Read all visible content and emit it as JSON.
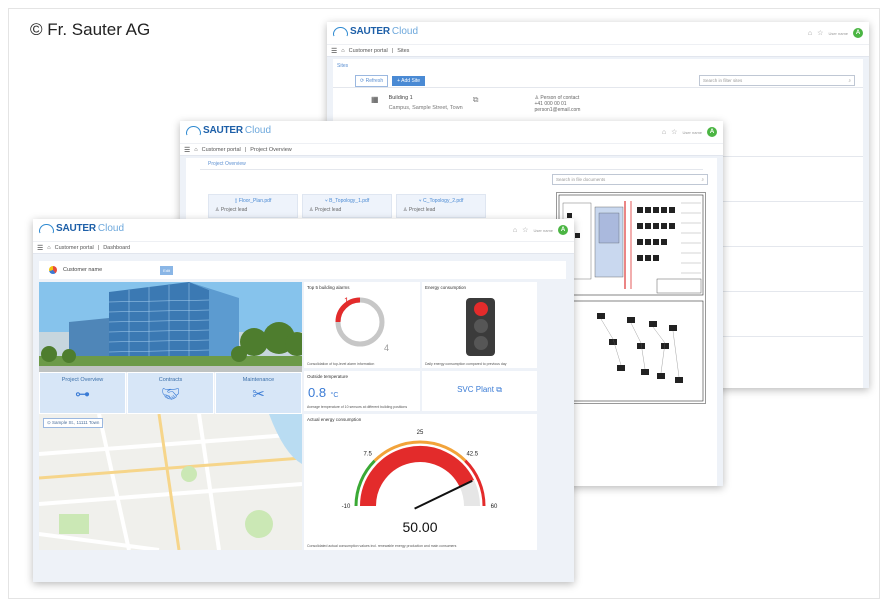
{
  "copyright": "© Fr. Sauter AG",
  "brand": {
    "name_bold": "SAUTER",
    "name_light": "Cloud"
  },
  "user": {
    "name": "User name",
    "initial": "A"
  },
  "colors": {
    "brand_blue": "#1d5fa8",
    "accent": "#4a8ad4",
    "avatar": "#4bb543",
    "alarm_red": "#e32b2b",
    "gauge_orange": "#f2a33a",
    "gauge_green": "#3aa935"
  },
  "sites_window": {
    "breadcrumb": [
      "Customer portal",
      "Sites"
    ],
    "section_title": "Sites",
    "refresh_label": "Refresh",
    "add_label": "Add Site",
    "search_placeholder": "Search in filter sites",
    "building": {
      "name": "Building 1",
      "address": "Campus, Sample Street, Town"
    },
    "contact": {
      "label": "Person of contact",
      "phone": "+41 000 00 01",
      "email": "person1@email.com"
    }
  },
  "project_window": {
    "breadcrumb": [
      "Customer portal",
      "Project Overview"
    ],
    "section_title": "Project Overview",
    "search_placeholder": "Search in file documents",
    "documents": [
      {
        "name": "Floor_Plan.pdf",
        "role": "Project lead"
      },
      {
        "name": "B_Topology_1.pdf",
        "role": "Project lead"
      },
      {
        "name": "C_Topology_2.pdf",
        "role": "Project lead"
      }
    ]
  },
  "dashboard_window": {
    "breadcrumb": [
      "Customer portal",
      "Dashboard"
    ],
    "customer_name": "Customer name",
    "edit_label": "Edit",
    "tiles": [
      {
        "label": "Project Overview",
        "icon": "hierarchy-icon"
      },
      {
        "label": "Contracts",
        "icon": "handshake-icon"
      },
      {
        "label": "Maintenance",
        "icon": "tools-icon"
      }
    ],
    "map_address": "Sample St., 11111 Town",
    "alarms": {
      "title": "Top 5 building alarms",
      "active": "1",
      "total": "4",
      "footer": "Consolidation of top-level alarm information"
    },
    "energy": {
      "title": "Energy consumption",
      "footer": "Daily energy consumption compared to previous day",
      "light": "red"
    },
    "temperature": {
      "title": "Outside temperature",
      "value": "0.8",
      "unit": "°C",
      "footer": "Average temperature of 10 sensors at different building positions"
    },
    "svc_plant": {
      "label": "SVC Plant",
      "icon": "external-link-icon"
    },
    "gauge": {
      "title": "Actual energy consumption",
      "min": -10,
      "max": 60,
      "value": 50.0,
      "display": "50.00",
      "ticks": [
        "-10",
        "7.5",
        "25",
        "42.5",
        "60"
      ],
      "footer": "Consolidated actual consumption values incl. renewable energy production and main consumers"
    }
  }
}
